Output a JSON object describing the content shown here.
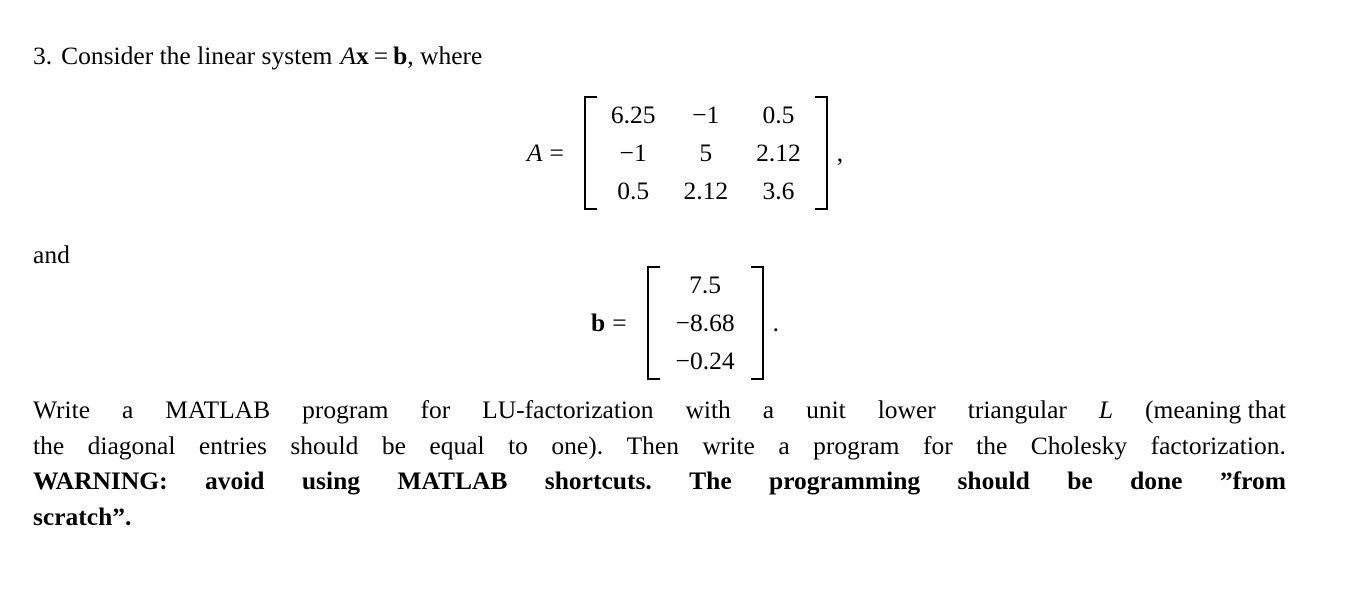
{
  "document": {
    "problem_number": "3.",
    "intro": {
      "before_math": "Consider the linear system",
      "math_A": "A",
      "math_x": "x",
      "equals": "=",
      "math_b": "b",
      "after_math": ", where"
    },
    "equation_A": {
      "label_var": "A",
      "label_equals": "=",
      "matrix": [
        [
          "6.25",
          "−1",
          "0.5"
        ],
        [
          "−1",
          "5",
          "2.12"
        ],
        [
          "0.5",
          "2.12",
          "3.6"
        ]
      ],
      "trailing_punctuation": ","
    },
    "connector": "and",
    "equation_b": {
      "label_var": "b",
      "label_equals": "=",
      "vector": [
        "7.5",
        "−8.68",
        "−0.24"
      ],
      "trailing_punctuation": "."
    },
    "paragraph": {
      "line1_left": "Write",
      "line1_words": [
        "Write",
        "a",
        "MATLAB",
        "program",
        "for",
        "LU-factorization",
        "with",
        "a",
        "unit",
        "lower",
        "triangular"
      ],
      "line1_italic_var": "L",
      "line1_tail": "(meaning that",
      "line2_words": [
        "the",
        "diagonal",
        "entries",
        "should",
        "be",
        "equal",
        "to",
        "one).",
        "Then",
        "write",
        "a",
        "program",
        "for",
        "the",
        "Cholesky",
        "factorization."
      ],
      "line3_bold": [
        "WARNING:",
        "avoid",
        "using",
        "MATLAB",
        "shortcuts.",
        "The",
        "programming",
        "should",
        "be",
        "done",
        "”from"
      ],
      "line4_bold": "scratch”."
    }
  },
  "colors": {
    "page_background": "#ffffff",
    "text": "#000000"
  }
}
